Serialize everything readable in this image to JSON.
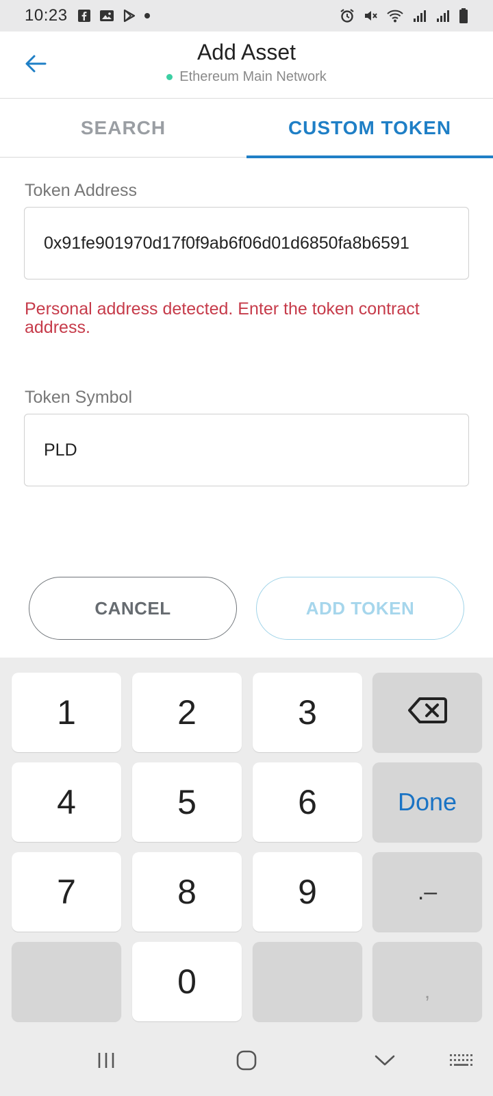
{
  "status_bar": {
    "time": "10:23",
    "left_icons": [
      "facebook-icon",
      "gallery-icon",
      "play-store-icon",
      "notification-dot-icon"
    ],
    "right_icons": [
      "alarm-icon",
      "mute-icon",
      "wifi-icon",
      "signal-icon",
      "signal-icon",
      "battery-icon"
    ]
  },
  "header": {
    "title": "Add Asset",
    "subtitle": "Ethereum Main Network",
    "network_dot_color": "#3ccfa3",
    "back_icon": "arrow-left-icon",
    "accent_color": "#1f7fc6"
  },
  "tabs": [
    {
      "label": "SEARCH",
      "active": false
    },
    {
      "label": "CUSTOM TOKEN",
      "active": true
    }
  ],
  "form": {
    "token_address": {
      "label": "Token Address",
      "value": "0x91fe901970d17f0f9ab6f06d01d6850fa8b6591"
    },
    "error": "Personal address detected. Enter the token contract address.",
    "error_color": "#c63b4a",
    "token_symbol": {
      "label": "Token Symbol",
      "value": "PLD"
    }
  },
  "buttons": {
    "cancel": "CANCEL",
    "add_token": "ADD TOKEN"
  },
  "keyboard": {
    "rows": [
      [
        "1",
        "2",
        "3",
        "⌫"
      ],
      [
        "4",
        "5",
        "6",
        "Done"
      ],
      [
        "7",
        "8",
        "9",
        ".–"
      ],
      [
        "",
        "0",
        "",
        ","
      ]
    ],
    "done_color": "#1a73c4"
  },
  "nav_bar": {
    "buttons": [
      "recents-icon",
      "home-icon",
      "back-down-icon",
      "keyboard-icon"
    ]
  }
}
